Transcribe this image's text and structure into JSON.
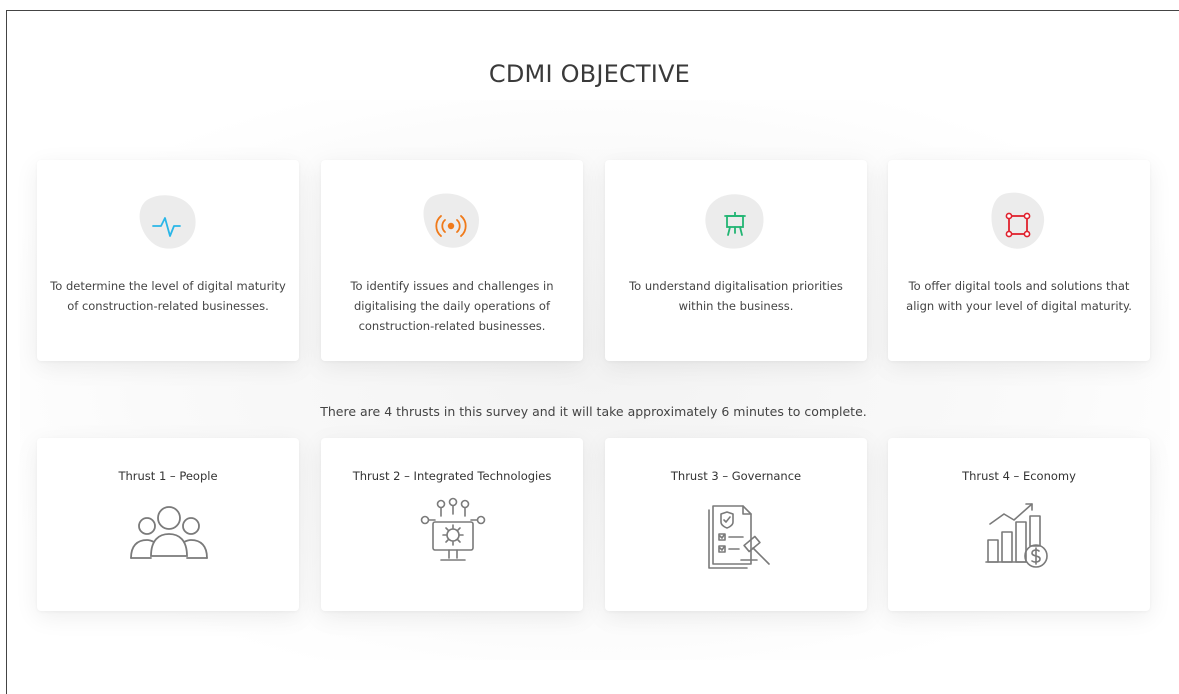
{
  "page": {
    "title": "CDMI OBJECTIVE",
    "survey_note": "There are 4 thrusts in this survey and it will take approximately 6 minutes to complete."
  },
  "objectives": [
    {
      "icon": "pulse-icon",
      "color": "#29b6e8",
      "text": "To determine the level of digital maturity of construction-related businesses."
    },
    {
      "icon": "broadcast-icon",
      "color": "#f07a1a",
      "text": "To identify issues and challenges in digitalising the daily operations of construction-related businesses."
    },
    {
      "icon": "presentation-easel-icon",
      "color": "#22b573",
      "text": "To understand digitalisation priorities within the business."
    },
    {
      "icon": "vector-square-icon",
      "color": "#e0222e",
      "text": "To offer digital tools and solutions that align with your level of digital maturity."
    }
  ],
  "thrusts": [
    {
      "label": "Thrust 1 – People",
      "icon": "people-group-icon"
    },
    {
      "label": "Thrust 2 – Integrated Technologies",
      "icon": "integrated-tech-monitor-icon"
    },
    {
      "label": "Thrust 3 – Governance",
      "icon": "governance-document-gavel-icon"
    },
    {
      "label": "Thrust 4 – Economy",
      "icon": "economy-growth-chart-icon"
    }
  ],
  "colors": {
    "blob": "#ececec",
    "line_icon": "#7a7a7a"
  }
}
